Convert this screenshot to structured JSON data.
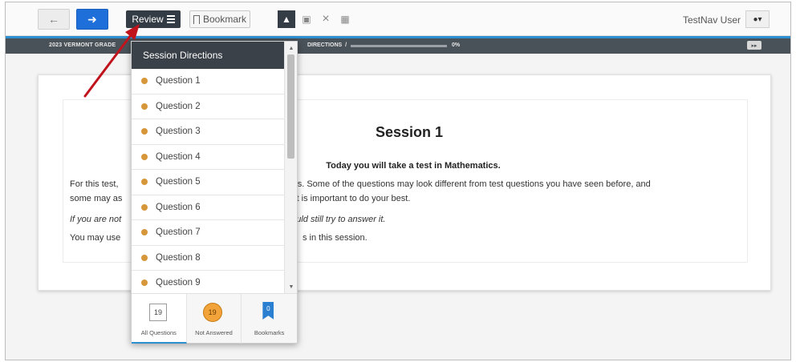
{
  "toolbar": {
    "back_icon": "arrow-left",
    "next_icon": "arrow-right",
    "review_label": "Review",
    "bookmark_label": "Bookmark",
    "tools": [
      "pointer-icon",
      "answer-masking-icon",
      "eliminate-icon",
      "notepad-icon"
    ],
    "user_name": "TestNav User"
  },
  "infobar": {
    "test_name": "2023 VERMONT GRADE",
    "section": "DIRECTIONS",
    "separator": "/",
    "progress_percent_label": "0%",
    "progress_value": 0
  },
  "review_panel": {
    "header": "Session Directions",
    "questions": [
      {
        "label": "Question 1",
        "status": "not-answered"
      },
      {
        "label": "Question 2",
        "status": "not-answered"
      },
      {
        "label": "Question 3",
        "status": "not-answered"
      },
      {
        "label": "Question 4",
        "status": "not-answered"
      },
      {
        "label": "Question 5",
        "status": "not-answered"
      },
      {
        "label": "Question 6",
        "status": "not-answered"
      },
      {
        "label": "Question 7",
        "status": "not-answered"
      },
      {
        "label": "Question 8",
        "status": "not-answered"
      },
      {
        "label": "Question 9",
        "status": "not-answered"
      }
    ],
    "tabs": {
      "all": {
        "count": "19",
        "label": "All Questions"
      },
      "not_answered": {
        "count": "19",
        "label": "Not Answered"
      },
      "bookmarks": {
        "count": "0",
        "label": "Bookmarks"
      }
    }
  },
  "content": {
    "title": "Session 1",
    "subtitle": "Today you will take a test in Mathematics.",
    "p1_line1_left": "For this test, ",
    "p1_line1_right": "tions. Some of the questions may look different from test questions you have seen before, and",
    "p1_line2_left": "some may as",
    "p1_line2_right": "t it is important to do your best.",
    "p2_left": "If you are not",
    "p2_right": "hould still try to answer it.",
    "p3_left": "You may use",
    "p3_right": "s in this session."
  },
  "colors": {
    "accent_blue": "#1e6fd9",
    "header_dark": "#3a4148",
    "not_answered_orange": "#d6963a",
    "annotation_red": "#c0141c"
  }
}
